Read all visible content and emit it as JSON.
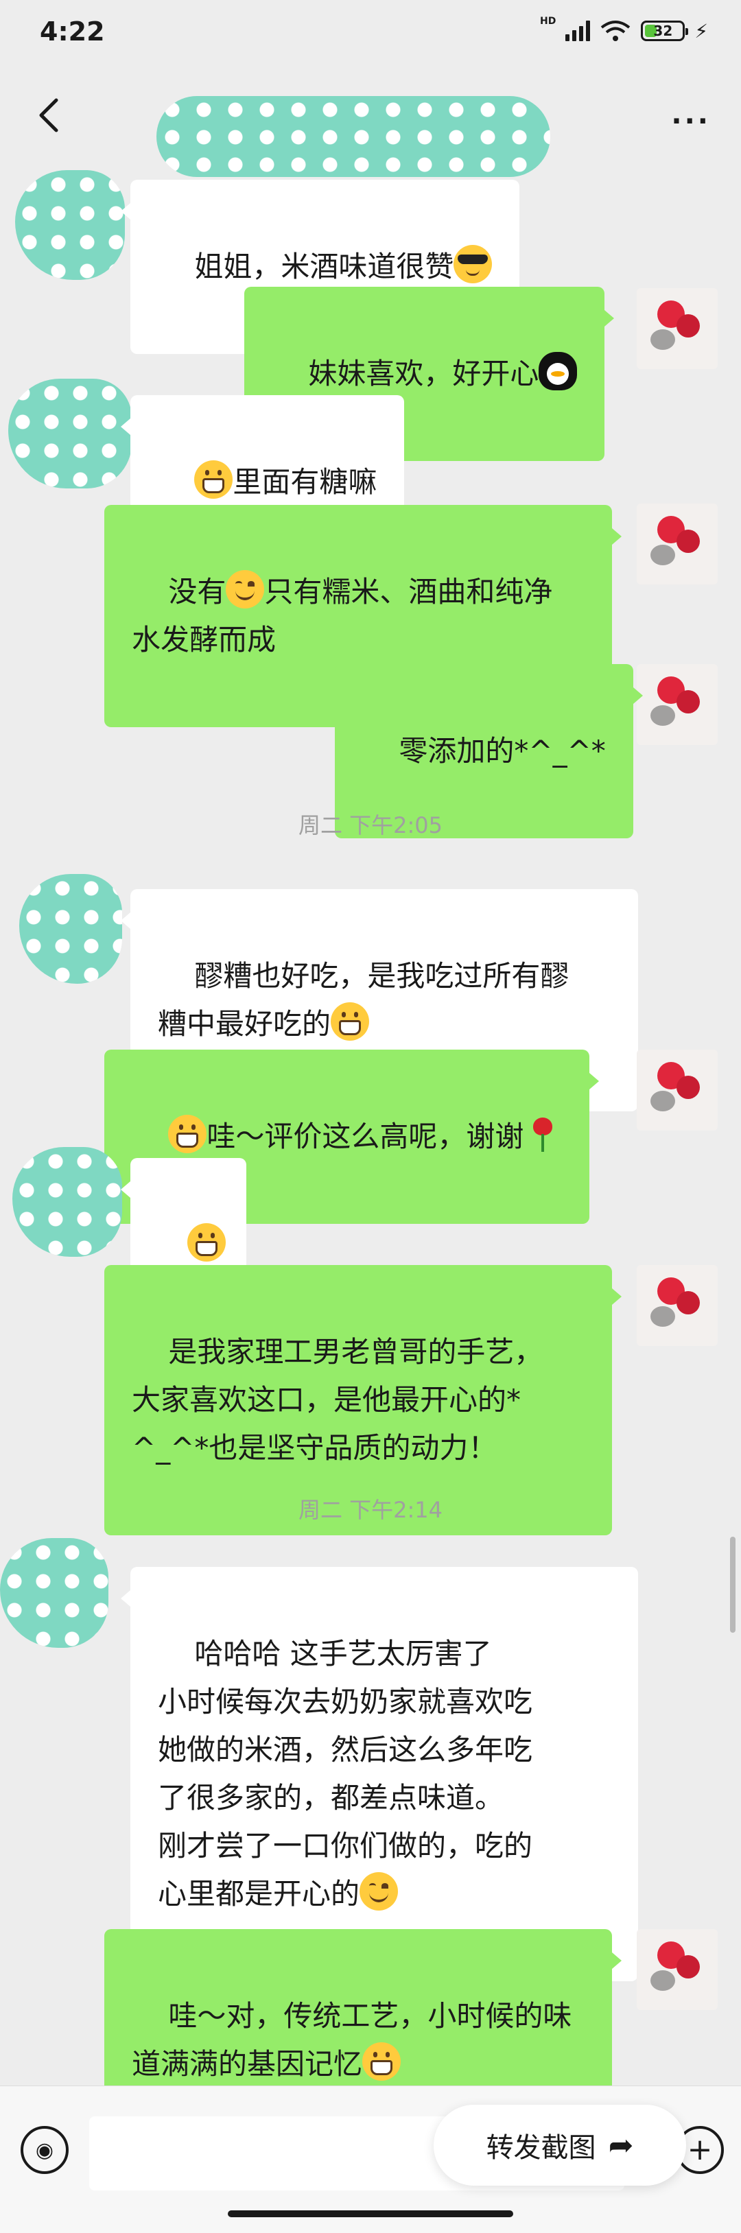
{
  "status_bar": {
    "time": "4:22",
    "network_label": "HD",
    "battery_level": "32",
    "icons": [
      "signal-icon",
      "wifi-icon",
      "battery-icon",
      "charging-icon"
    ]
  },
  "header": {
    "back_icon": "chevron-left-icon",
    "more_label": "···"
  },
  "messages": [
    {
      "side": "in",
      "text": "姐姐，米酒味道很赞",
      "emoji_after": "cool-emoji"
    },
    {
      "side": "out",
      "text": "妹妹喜欢，好开心",
      "emoji_after": "penguin-emoji"
    },
    {
      "side": "in",
      "text": "里面有糖嘛",
      "emoji_before": "grin-emoji"
    },
    {
      "side": "out",
      "text_line1_a": "没有",
      "text_line1_b": "只有糯米、酒曲和纯净",
      "text_line2": "水发酵而成",
      "emoji_inline": "smile-emoji"
    },
    {
      "side": "out",
      "text": "零添加的*^_^*"
    },
    {
      "side": "in",
      "text_line1": "醪糟也好吃，是我吃过所有醪",
      "text_line2": "糟中最好吃的",
      "emoji_after": "grin-emoji"
    },
    {
      "side": "out",
      "text": "哇～评价这么高呢，谢谢",
      "emoji_before": "grin-emoji",
      "emoji_after": "rose-emoji"
    },
    {
      "side": "in",
      "emoji_only": "grin-emoji"
    },
    {
      "side": "out",
      "lines": [
        "是我家理工男老曾哥的手艺，",
        "大家喜欢这口，是他最开心的*",
        "^_^*也是坚守品质的动力！"
      ]
    },
    {
      "side": "in",
      "lines": [
        "哈哈哈 这手艺太厉害了",
        "小时候每次去奶奶家就喜欢吃",
        "她做的米酒，然后这么多年吃",
        "了很多家的，都差点味道。",
        "刚才尝了一口你们做的，吃的",
        "心里都是开心的"
      ],
      "emoji_after": "smile-emoji"
    },
    {
      "side": "out",
      "lines": [
        "哇～对，传统工艺，小时候的味",
        "道满满的基因记忆"
      ],
      "emoji_after": "grin-emoji"
    }
  ],
  "timestamps": [
    "周二 下午2:05",
    "周二 下午2:14"
  ],
  "input_bar": {
    "voice_icon": "voice-icon",
    "plus_icon": "plus-icon",
    "forward_label": "转发截图",
    "forward_icon": "share-arrow-icon"
  }
}
